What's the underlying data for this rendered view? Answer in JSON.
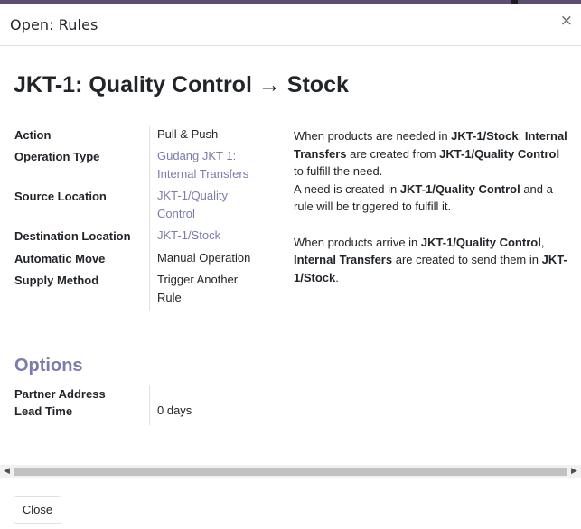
{
  "modal": {
    "title": "Open: Rules",
    "close_symbol": "×"
  },
  "record": {
    "title": "JKT-1: Quality Control → Stock"
  },
  "fields": [
    {
      "label": "Action",
      "value_lines": [
        "Pull & Push"
      ],
      "link": false
    },
    {
      "label": "Operation Type",
      "value_lines": [
        "Gudang JKT 1:",
        "Internal Transfers"
      ],
      "link": true
    },
    {
      "label": "Source Location",
      "value_lines": [
        "JKT-1/Quality",
        "Control"
      ],
      "link": true
    },
    {
      "label": "Destination Location",
      "value_lines": [
        "JKT-1/Stock"
      ],
      "link": true
    },
    {
      "label": "Automatic Move",
      "value_lines": [
        "Manual Operation"
      ],
      "link": false
    },
    {
      "label": "Supply Method",
      "value_lines": [
        "Trigger Another",
        "Rule"
      ],
      "link": false
    }
  ],
  "explanation": {
    "p1": {
      "t1": "When products are needed in ",
      "b1": "JKT-1/Stock",
      "t2": ", ",
      "b2": "Internal Transfers",
      "t3": " are created from ",
      "b3": "JKT-1/Quality Control",
      "t4": " to fulfill the need."
    },
    "p2": {
      "t1": "A need is created in ",
      "b1": "JKT-1/Quality Control",
      "t2": " and a rule will be triggered to fulfill it."
    },
    "p3": {
      "t1": "When products arrive in ",
      "b1": "JKT-1/Quality Control",
      "t2": ", ",
      "b2": "Internal Transfers",
      "t3": " are created to send them in ",
      "b3": "JKT-1/Stock",
      "t4": "."
    }
  },
  "options": {
    "title": "Options",
    "fields": [
      {
        "label": "Partner Address",
        "value": ""
      },
      {
        "label": "Lead Time",
        "value": "0 days"
      }
    ]
  },
  "footer": {
    "close_label": "Close"
  },
  "colors": {
    "link": "#7c7bad",
    "options_heading": "#7c7bad",
    "border": "#dee2e6"
  }
}
